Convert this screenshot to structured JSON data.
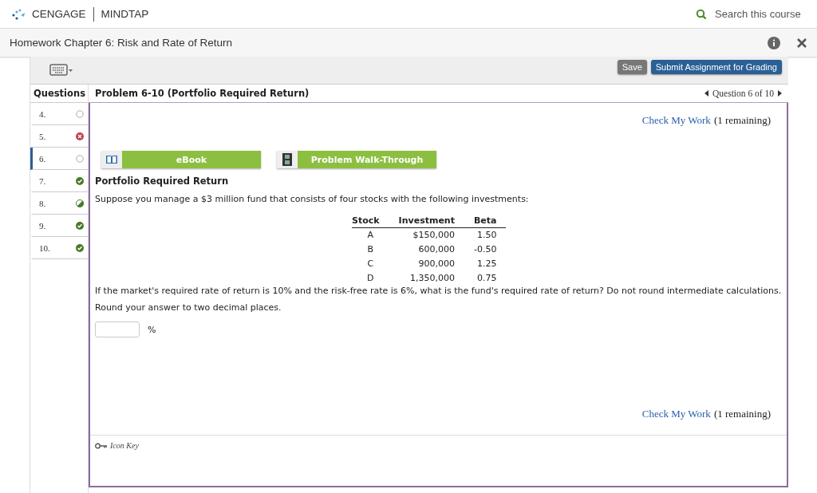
{
  "header": {
    "brand": "CENGAGE",
    "product": "MINDTAP",
    "search_placeholder": "Search this course"
  },
  "title_bar": {
    "title": "Homework Chapter 6: Risk and Rate of Return"
  },
  "toolbar": {
    "buttons": [
      {
        "label": "Save",
        "kind": "secondary"
      },
      {
        "label": "Submit Assignment for Grading",
        "kind": "primary"
      }
    ]
  },
  "questions": {
    "heading": "Questions",
    "items": [
      {
        "number": "4.",
        "kind": "unanswered",
        "selected": false
      },
      {
        "number": "5.",
        "kind": "incorrect",
        "selected": false
      },
      {
        "number": "6.",
        "kind": "unanswered",
        "selected": true
      },
      {
        "number": "7.",
        "kind": "correct",
        "selected": false
      },
      {
        "number": "8.",
        "kind": "partial",
        "selected": false
      },
      {
        "number": "9.",
        "kind": "correct",
        "selected": false
      },
      {
        "number": "10.",
        "kind": "correct",
        "selected": false
      }
    ]
  },
  "problem": {
    "title": "Problem 6-10 (Portfolio Required Return)",
    "nav": "Question 6 of 10",
    "check_top": {
      "link": "Check My Work",
      "remaining": "(1 remaining)"
    },
    "resources": [
      {
        "label": "eBook",
        "kind": "book"
      },
      {
        "label": "Problem Walk-Through",
        "kind": "film"
      }
    ],
    "heading": "Portfolio Required Return",
    "intro": "Suppose you manage a $3 million fund that consists of four stocks with the following investments:",
    "table": {
      "columns": [
        "Stock",
        "Investment",
        "Beta"
      ],
      "rows": [
        [
          "A",
          "$150,000",
          "1.50"
        ],
        [
          "B",
          "600,000",
          "-0.50"
        ],
        [
          "C",
          "900,000",
          "1.25"
        ],
        [
          "D",
          "1,350,000",
          "0.75"
        ]
      ]
    },
    "question": "If the market's required rate of return is 10% and the risk-free rate is 6%, what is the fund's required rate of return? Do not round intermediate calculations.",
    "instruction": "Round your answer to two decimal places.",
    "unit": "%",
    "check_bottom": {
      "link": "Check My Work",
      "remaining": "(1 remaining)"
    },
    "icon_key": "Icon Key"
  }
}
